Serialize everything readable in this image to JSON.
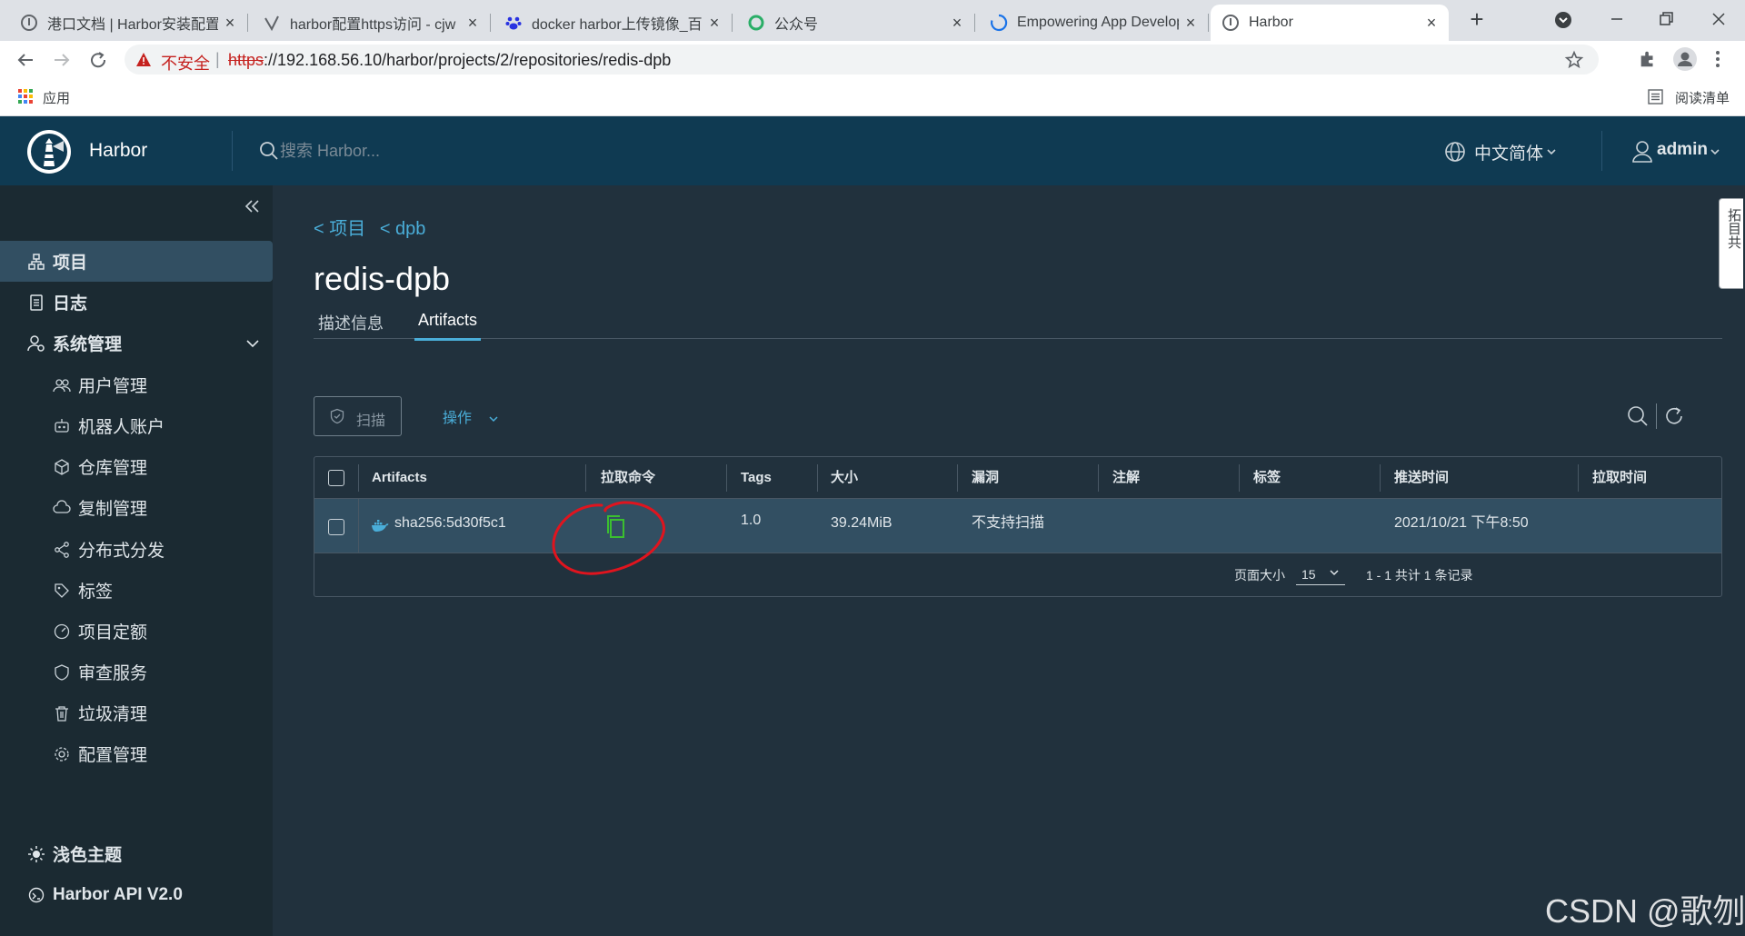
{
  "browser": {
    "tabs": [
      {
        "title": "港口文档 | Harbor安装配置",
        "close": "×"
      },
      {
        "title": "harbor配置https访问 - cjw",
        "close": "×"
      },
      {
        "title": "docker harbor上传镜像_百",
        "close": "×"
      },
      {
        "title": "公众号",
        "close": "×"
      },
      {
        "title": "Empowering App Develop",
        "close": "×"
      },
      {
        "title": "Harbor",
        "close": "×"
      }
    ],
    "new_tab": "+",
    "security_label": "不安全",
    "url_scheme": "https",
    "url_rest": "://192.168.56.10/harbor/projects/2/repositories/redis-dpb",
    "bookmark_apps": "应用",
    "reading_list": "阅读清单"
  },
  "header": {
    "brand": "Harbor",
    "search_placeholder": "搜索 Harbor...",
    "language": "中文简体",
    "user": "admin"
  },
  "sidebar": {
    "items": [
      {
        "label": "项目",
        "icon": "projects-icon",
        "active": true
      },
      {
        "label": "日志",
        "icon": "logs-icon"
      },
      {
        "label": "系统管理",
        "icon": "admin-icon",
        "expandable": true
      }
    ],
    "sub_items": [
      {
        "label": "用户管理",
        "icon": "users-icon"
      },
      {
        "label": "机器人账户",
        "icon": "robot-icon"
      },
      {
        "label": "仓库管理",
        "icon": "registry-icon"
      },
      {
        "label": "复制管理",
        "icon": "replication-icon"
      },
      {
        "label": "分布式分发",
        "icon": "distribution-icon"
      },
      {
        "label": "标签",
        "icon": "tag-icon"
      },
      {
        "label": "项目定额",
        "icon": "quota-icon"
      },
      {
        "label": "审查服务",
        "icon": "shield-icon"
      },
      {
        "label": "垃圾清理",
        "icon": "trash-icon"
      },
      {
        "label": "配置管理",
        "icon": "gear-icon"
      }
    ],
    "theme_label": "浅色主题",
    "api_label": "Harbor API V2.0"
  },
  "page": {
    "breadcrumb": [
      "< 项目",
      "< dpb"
    ],
    "title": "redis-dpb",
    "tabs": [
      "描述信息",
      "Artifacts"
    ],
    "active_tab": "Artifacts",
    "scan_button": "扫描",
    "actions_button": "操作",
    "side_tab": "拓目共"
  },
  "table": {
    "columns": [
      "Artifacts",
      "拉取命令",
      "Tags",
      "大小",
      "漏洞",
      "注解",
      "标签",
      "推送时间",
      "拉取时间"
    ],
    "rows": [
      {
        "artifact": "sha256:5d30f5c1",
        "tags": "1.0",
        "size": "39.24MiB",
        "vulnerabilities": "不支持扫描",
        "annotations": "",
        "labels": "",
        "push_time": "2021/10/21 下午8:50",
        "pull_time": ""
      }
    ],
    "page_size_label": "页面大小",
    "page_size": "15",
    "pagination": "1 - 1 共计 1 条记录"
  },
  "watermark": "CSDN @歌刎",
  "colors": {
    "header_bg": "#0f3a52",
    "sidebar_bg": "#1b2a32",
    "content_bg": "#21313d",
    "link": "#4aaed9",
    "row_bg": "#324f62",
    "annotation_red": "#e0141e",
    "copy_green": "#3bbf2f"
  }
}
